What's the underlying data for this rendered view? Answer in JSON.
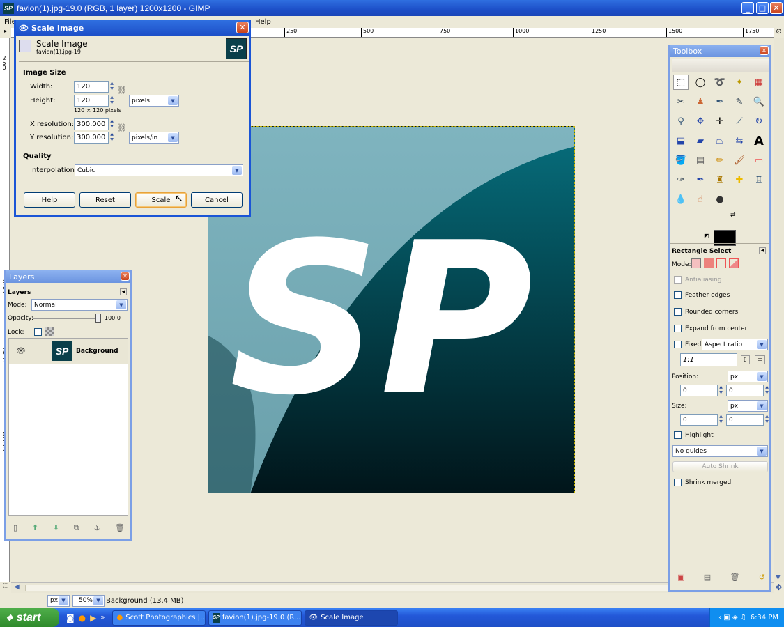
{
  "window": {
    "title": "favion(1).jpg-19.0 (RGB, 1 layer) 1200x1200 - GIMP",
    "min": "_",
    "max": "□",
    "close": "✕"
  },
  "menu": {
    "file": "File",
    "help": "Help"
  },
  "ruler": {
    "h": [
      "250",
      "500",
      "750",
      "1000",
      "1250",
      "1500",
      "1750"
    ],
    "v": [
      "250",
      "500",
      "750",
      "1000"
    ]
  },
  "scale_dialog": {
    "title": "Scale Image",
    "heading": "Scale Image",
    "subheading": "favion(1).jpg-19",
    "image_size_label": "Image Size",
    "width_label": "Width:",
    "width_value": "120",
    "height_label": "Height:",
    "height_value": "120",
    "size_hint": "120 × 120 pixels",
    "unit": "pixels",
    "xres_label": "X resolution:",
    "xres_value": "300.000",
    "yres_label": "Y resolution:",
    "yres_value": "300.000",
    "res_unit": "pixels/in",
    "quality_label": "Quality",
    "interp_label": "Interpolation:",
    "interp_value": "Cubic",
    "buttons": {
      "help": "Help",
      "reset": "Reset",
      "scale": "Scale",
      "cancel": "Cancel"
    }
  },
  "layers": {
    "title": "Layers",
    "tab": "Layers",
    "mode_label": "Mode:",
    "mode_value": "Normal",
    "opacity_label": "Opacity:",
    "opacity_value": "100.0",
    "lock_label": "Lock:",
    "layer_name": "Background",
    "logo_text": "SP"
  },
  "image": {
    "logo_text": "SP"
  },
  "toolbox": {
    "title": "Toolbox",
    "tool_options_title": "Rectangle Select",
    "mode_label": "Mode:",
    "antialiasing": "Antialiasing",
    "feather_edges": "Feather edges",
    "rounded_corners": "Rounded corners",
    "expand_from_center": "Expand from center",
    "fixed_label": "Fixed:",
    "fixed_value": "Aspect ratio",
    "ratio_value": "1:1",
    "position_label": "Position:",
    "position_unit": "px",
    "pos_x": "0",
    "pos_y": "0",
    "size_label": "Size:",
    "size_unit": "px",
    "size_x": "0",
    "size_y": "0",
    "highlight": "Highlight",
    "guides_value": "No guides",
    "auto_shrink": "Auto Shrink",
    "shrink_merged": "Shrink merged"
  },
  "status": {
    "unit": "px",
    "zoom": "50%",
    "info": "Background (13.4 MB)"
  },
  "taskbar": {
    "start": "start",
    "items": [
      "Scott Photographics |...",
      "favion(1).jpg-19.0 (R...",
      "Scale Image"
    ],
    "clock": "6:34 PM"
  }
}
